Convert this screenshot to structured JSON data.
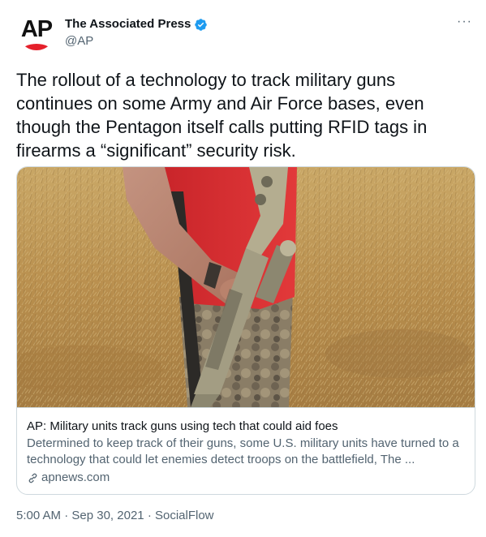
{
  "author": {
    "avatar_text": "AP",
    "display_name": "The Associated Press",
    "handle": "@AP",
    "verified": true
  },
  "more_menu": {
    "label": "···"
  },
  "tweet": {
    "text": "The rollout of a technology to track military guns continues on some Army and Air Force bases, even though the Pentagon itself calls putting RFID tags in firearms a “significant” security risk."
  },
  "card": {
    "title": "AP: Military units track guns using tech that could aid foes",
    "description": "Determined to keep track of their guns, some U.S. military units have turned to a technology that could let enemies detect troops on the battlefield, The ...",
    "domain": "apnews.com"
  },
  "meta": {
    "time": "5:00 AM",
    "separator": "·",
    "date": "Sep 30, 2021",
    "source": "SocialFlow"
  },
  "colors": {
    "text_primary": "#0f1419",
    "text_secondary": "#536471",
    "verified_blue": "#1d9bf0",
    "border": "#cfd9de",
    "ap_red": "#e5202b"
  },
  "icons": [
    "verified-badge-icon",
    "more-options-icon",
    "link-icon"
  ]
}
